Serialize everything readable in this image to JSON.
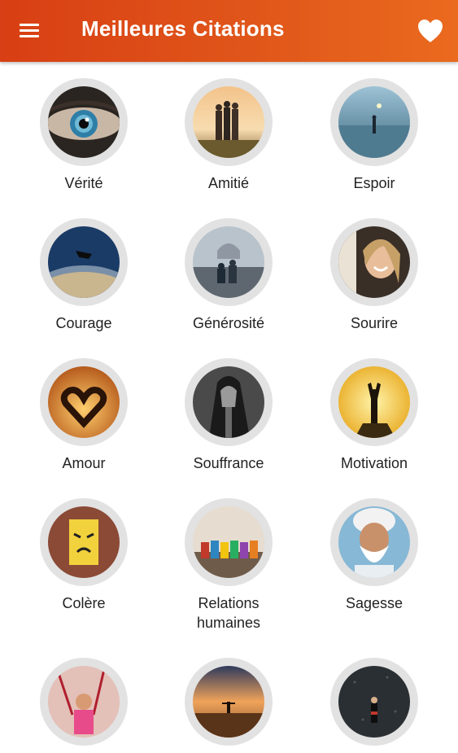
{
  "app_bar": {
    "title": "Meilleures Citations",
    "menu_icon": "hamburger-menu-icon",
    "favorites_icon": "heart-icon",
    "colors": {
      "start": "#d83f14",
      "end": "#ea6a1e",
      "text": "#ffffff"
    }
  },
  "categories": [
    {
      "label": "Vérité"
    },
    {
      "label": "Amitié"
    },
    {
      "label": "Espoir"
    },
    {
      "label": "Courage"
    },
    {
      "label": "Générosité"
    },
    {
      "label": "Sourire"
    },
    {
      "label": "Amour"
    },
    {
      "label": "Souffrance"
    },
    {
      "label": "Motivation"
    },
    {
      "label": "Colère"
    },
    {
      "label": "Relations humaines"
    },
    {
      "label": "Sagesse"
    },
    {
      "label": ""
    },
    {
      "label": ""
    },
    {
      "label": ""
    }
  ]
}
